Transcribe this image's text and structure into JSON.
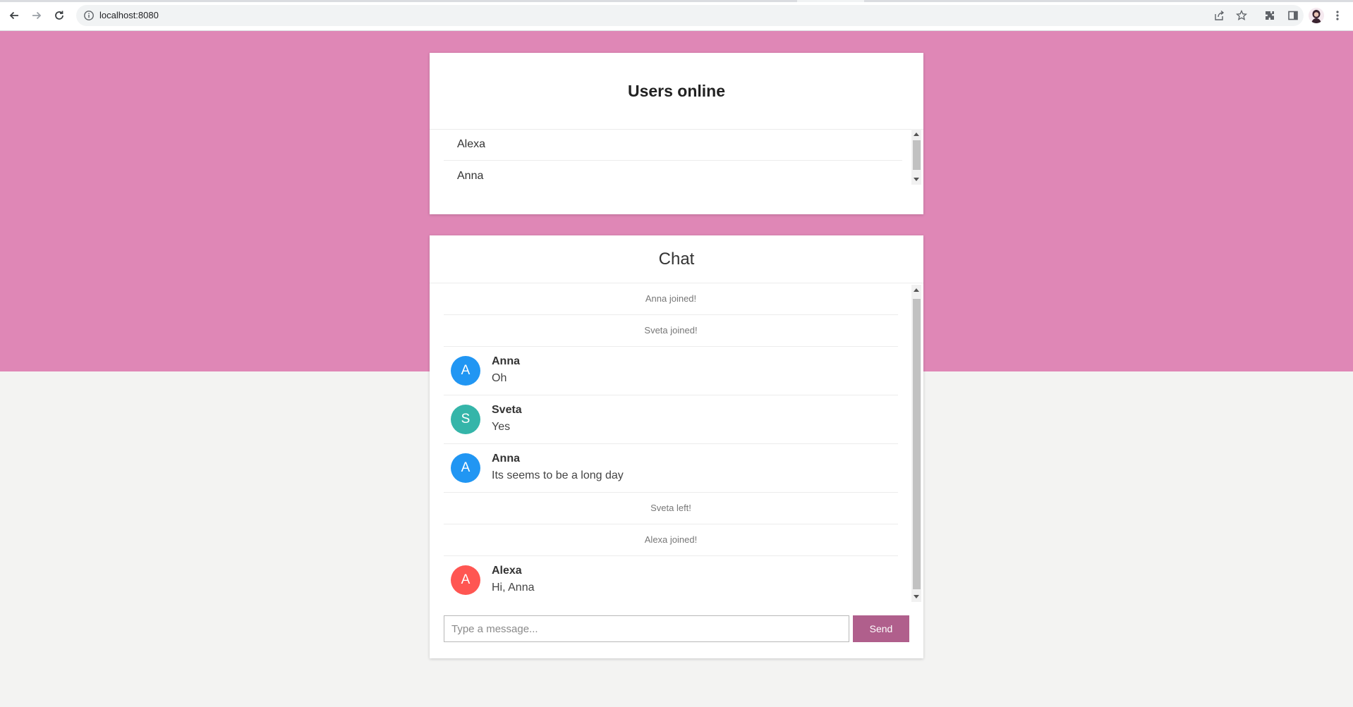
{
  "browser": {
    "url": "localhost:8080",
    "icons": [
      "back-arrow-icon",
      "forward-arrow-icon",
      "reload-icon",
      "info-icon",
      "share-icon",
      "star-icon",
      "extensions-icon",
      "side-panel-icon",
      "profile-avatar",
      "kebab-menu-icon"
    ]
  },
  "theme": {
    "hero_color": "#df87b6",
    "page_bg": "#f3f3f2",
    "send_button_color": "#b05f8c"
  },
  "users_panel": {
    "title": "Users online",
    "users": [
      "Alexa",
      "Anna"
    ]
  },
  "chat": {
    "title": "Chat",
    "messages": [
      {
        "type": "event",
        "text": "Anna joined!"
      },
      {
        "type": "event",
        "text": "Sveta joined!"
      },
      {
        "type": "message",
        "initial": "A",
        "sender": "Anna",
        "text": "Oh",
        "avatar_color": "#2196f3"
      },
      {
        "type": "message",
        "initial": "S",
        "sender": "Sveta",
        "text": "Yes",
        "avatar_color": "#35b5a9"
      },
      {
        "type": "message",
        "initial": "A",
        "sender": "Anna",
        "text": "Its seems to be a long day",
        "avatar_color": "#2196f3"
      },
      {
        "type": "event",
        "text": "Sveta left!"
      },
      {
        "type": "event",
        "text": "Alexa joined!"
      },
      {
        "type": "message",
        "initial": "A",
        "sender": "Alexa",
        "text": "Hi, Anna",
        "avatar_color": "#ff5652"
      }
    ],
    "input_placeholder": "Type a message...",
    "input_value": "",
    "send_label": "Send"
  }
}
